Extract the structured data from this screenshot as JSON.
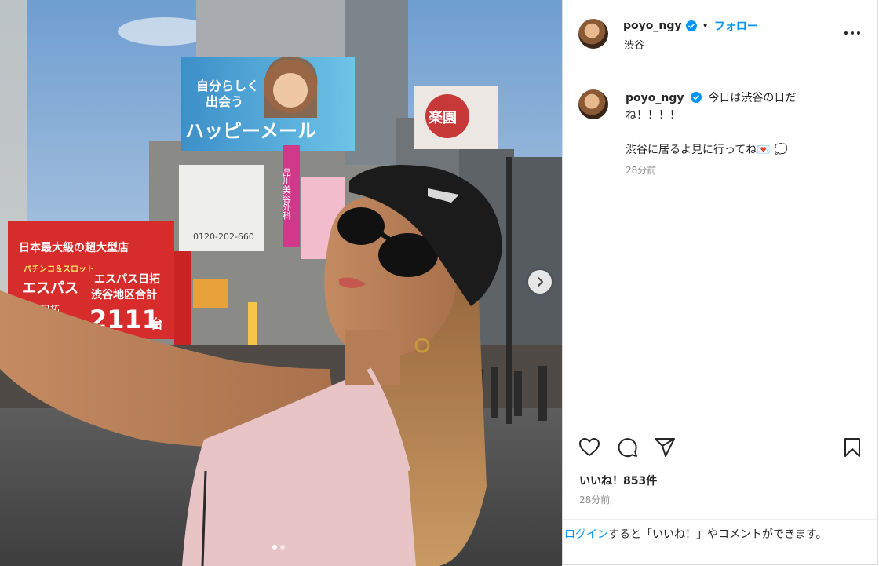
{
  "post": {
    "username": "poyo_ngy",
    "follow_label": "フォロー",
    "separator": "•",
    "location": "渋谷",
    "caption_line1": "今日は渋谷の日だね！！！！",
    "caption_line2": "渋谷に居るよ見に行ってね💌 💭",
    "caption_time": "28分前",
    "likes": "いいね！853件",
    "post_time": "28分前"
  },
  "photo": {
    "billboard_top_line1": "自分らしく",
    "billboard_top_line2": "出会う",
    "billboard_top_main": "ハッピーメール",
    "billboard_right": "楽園",
    "sign_phone": "0120-202-660",
    "sign_red_title": "日本最大級の超大型店",
    "sign_red_left1": "パチンコ＆スロット",
    "sign_red_left2": "エスパス",
    "sign_red_left3": "日拓",
    "sign_red_right1": "エスパス日拓",
    "sign_red_right2": "渋谷地区合計",
    "sign_red_number": "2111",
    "sign_red_unit": "台",
    "sign_vertical": "品川美容外科",
    "slide_count": 2,
    "active_slide": 1
  },
  "login": {
    "link_text": "ログイン",
    "rest_text": "すると「いいね！」やコメントができます。"
  },
  "colors": {
    "accent": "#0095f6",
    "muted": "#8e8e8e",
    "text": "#262626"
  }
}
